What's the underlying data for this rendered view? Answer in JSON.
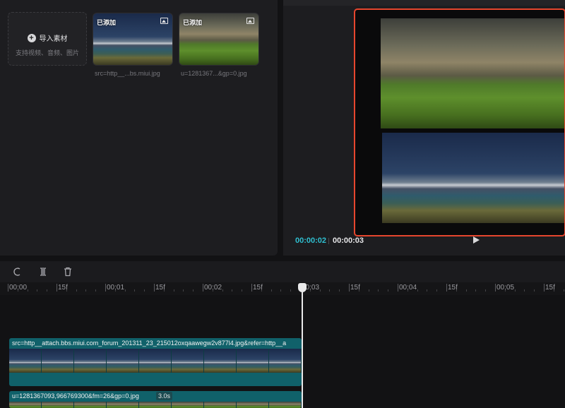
{
  "media": {
    "import_label": "导入素材",
    "import_hint": "支持视频、音频、图片",
    "items": [
      {
        "badge": "已添加",
        "caption": "src=http__...bs.miui.jpg",
        "icon": "image-icon"
      },
      {
        "badge": "已添加",
        "caption": "u=1281367...&gp=0.jpg",
        "icon": "image-icon"
      }
    ]
  },
  "preview": {
    "current_time": "00:00:02",
    "total_time": "00:00:03",
    "accent_color": "#2fbfd0",
    "selection_color": "#e6462e"
  },
  "toolbar": {
    "undo_icon": "undo-icon",
    "split_icon": "split-icon",
    "delete_icon": "trash-icon"
  },
  "ruler": {
    "ticks": [
      "00:00",
      "15f",
      "00:01",
      "15f",
      "00:02",
      "15f",
      "00:03",
      "15f",
      "00:04",
      "15f",
      "00:05",
      "15f"
    ]
  },
  "timeline": {
    "clips": [
      {
        "label": "src=http__attach.bbs.miui.com_forum_201311_23_215012oxqaawegw2v877l4.jpg&refer=http__a"
      },
      {
        "label": "u=1281367093,966769300&fm=26&gp=0.jpg",
        "duration": "3.0s"
      }
    ],
    "clip_color": "#10616a"
  }
}
